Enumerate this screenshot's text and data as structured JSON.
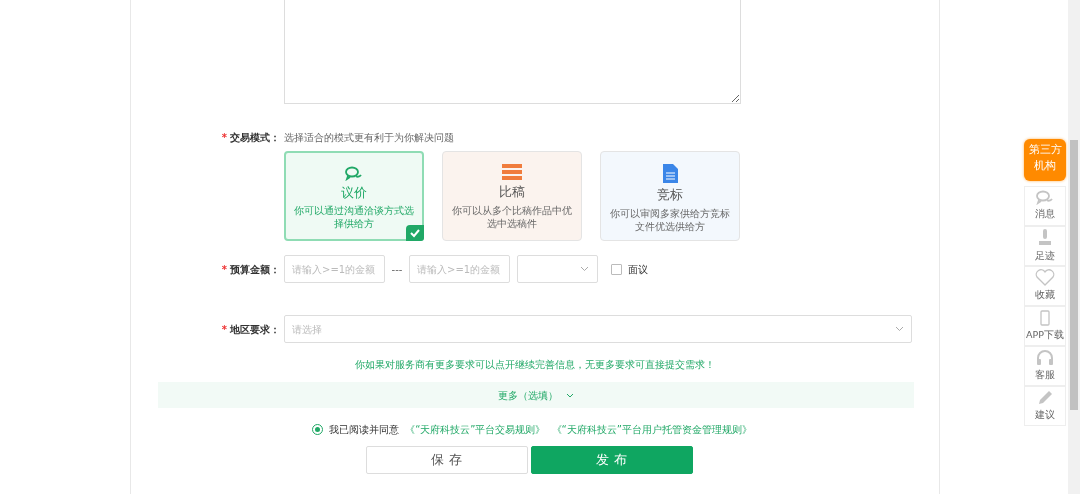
{
  "trade_mode": {
    "label": "交易模式：",
    "required_mark": "*",
    "hint": "选择适合的模式更有利于为你解决问题",
    "options": [
      {
        "kind": "chat",
        "title": "议价",
        "description": "你可以通过沟通洽谈方式选择供给方",
        "selected": true
      },
      {
        "kind": "list",
        "title": "比稿",
        "description": "你可以从多个比稿作品中优选中选稿件",
        "selected": false
      },
      {
        "kind": "document",
        "title": "竞标",
        "description": "你可以审阅多家供给方竞标文件优选供给方",
        "selected": false
      }
    ]
  },
  "budget": {
    "label": "预算金额：",
    "required_mark": "*",
    "min_placeholder": "请输入>=1的金额",
    "separator": "---",
    "max_placeholder": "请输入>=1的金额",
    "negotiable": {
      "label": "面议",
      "checked": false
    }
  },
  "region": {
    "label": "地区要求：",
    "required_mark": "*",
    "placeholder": "请选择"
  },
  "notice": "你如果对服务商有更多要求可以点开继续完善信息，无更多要求可直接提交需求！",
  "more": {
    "label": "更多（选填）",
    "expanded": false
  },
  "agreement": {
    "checked": true,
    "prefix": "我已阅读并同意",
    "links": [
      "《“天府科技云”平台交易规则》",
      "《“天府科技云”平台用户托管资金管理规则》"
    ]
  },
  "buttons": [
    {
      "kind": "secondary",
      "label": "保 存"
    },
    {
      "kind": "primary",
      "label": "发 布"
    }
  ],
  "side_panel": {
    "highlight": "第三方机构",
    "items": [
      {
        "kind": "chat",
        "label": "消息"
      },
      {
        "kind": "footprint",
        "label": "足迹"
      },
      {
        "kind": "heart",
        "label": "收藏"
      },
      {
        "kind": "phone",
        "label": "APP下载"
      },
      {
        "kind": "headset",
        "label": "客服"
      },
      {
        "kind": "pencil",
        "label": "建议"
      }
    ]
  }
}
